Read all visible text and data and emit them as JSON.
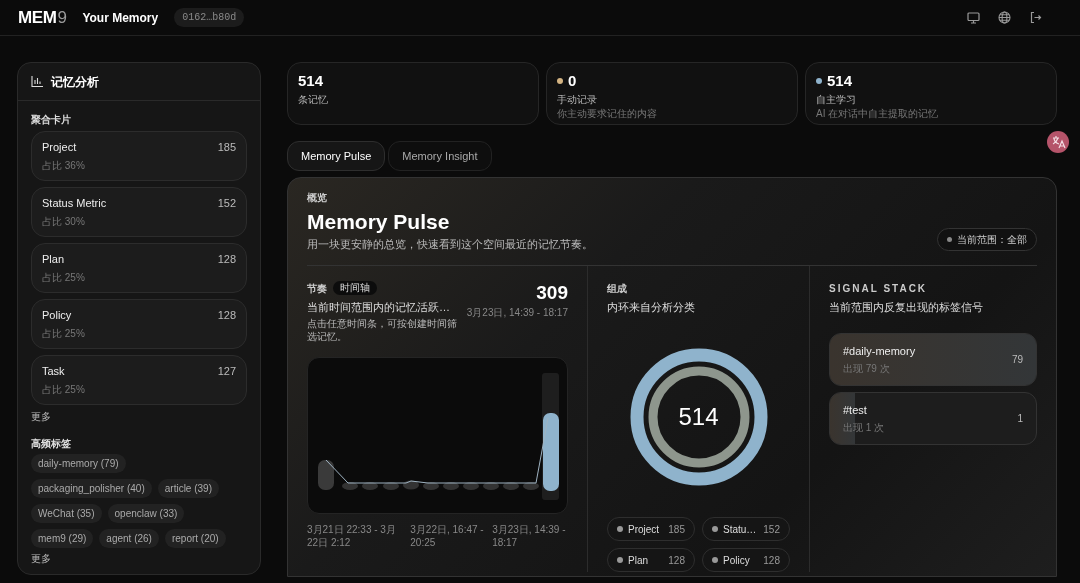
{
  "header": {
    "logo_main": "MEM",
    "logo_digit": "9",
    "title": "Your Memory",
    "space_id": "0162…b80d"
  },
  "sidebar": {
    "title": "记忆分析",
    "cards_heading": "聚合卡片",
    "cards": [
      {
        "name": "Project",
        "count": "185",
        "share": "占比 36%"
      },
      {
        "name": "Status Metric",
        "count": "152",
        "share": "占比 30%"
      },
      {
        "name": "Plan",
        "count": "128",
        "share": "占比 25%"
      },
      {
        "name": "Policy",
        "count": "128",
        "share": "占比 25%"
      },
      {
        "name": "Task",
        "count": "127",
        "share": "占比 25%"
      }
    ],
    "cards_more": "更多",
    "tags_heading": "高频标签",
    "tags": [
      "daily-memory (79)",
      "packaging_polisher (40)",
      "article (39)",
      "WeChat (35)",
      "openclaw (33)",
      "mem9 (29)",
      "agent (26)",
      "report (20)"
    ],
    "tags_more": "更多"
  },
  "stats": [
    {
      "value": "514",
      "label": "条记忆"
    },
    {
      "value": "0",
      "label": "手动记录",
      "note": "你主动要求记住的内容",
      "color": "#d4b483"
    },
    {
      "value": "514",
      "label": "自主学习",
      "note": "AI 在对话中自主提取的记忆",
      "color": "#8fb3cc"
    }
  ],
  "tabs": [
    {
      "label": "Memory Pulse",
      "selected": true
    },
    {
      "label": "Memory Insight",
      "selected": false
    }
  ],
  "panel": {
    "eyebrow": "概览",
    "title": "Memory Pulse",
    "subtitle": "用一块更安静的总览，快速看到这个空间最近的记忆节奏。",
    "scope": "当前范围：全部",
    "rhythm": {
      "label": "节奏",
      "badge": "时间轴",
      "headline": "当前时间范围内的记忆活跃…",
      "hint": "点击任意时间条，可按创建时间筛选记忆。",
      "total": "309",
      "range": "3月23日, 14:39 - 18:17",
      "axis_labels": [
        "3月21日 22:33 - 3月22日 2:12",
        "3月22日, 16:47 - 20:25",
        "3月23日, 14:39 - 18:17"
      ]
    },
    "composition": {
      "label": "组成",
      "headline": "内环来自分析分类",
      "center": "514",
      "legend": [
        {
          "name": "Project",
          "count": "185"
        },
        {
          "name": "Statu…",
          "count": "152"
        },
        {
          "name": "Plan",
          "count": "128"
        },
        {
          "name": "Policy",
          "count": "128"
        }
      ]
    },
    "signals": {
      "label": "SIGNAL STACK",
      "headline": "当前范围内反复出现的标签信号",
      "items": [
        {
          "tag": "#daily-memory",
          "note": "出现 79 次",
          "count": "79",
          "level": 1
        },
        {
          "tag": "#test",
          "note": "出现 1 次",
          "count": "1",
          "level": 0.12
        }
      ]
    }
  }
}
